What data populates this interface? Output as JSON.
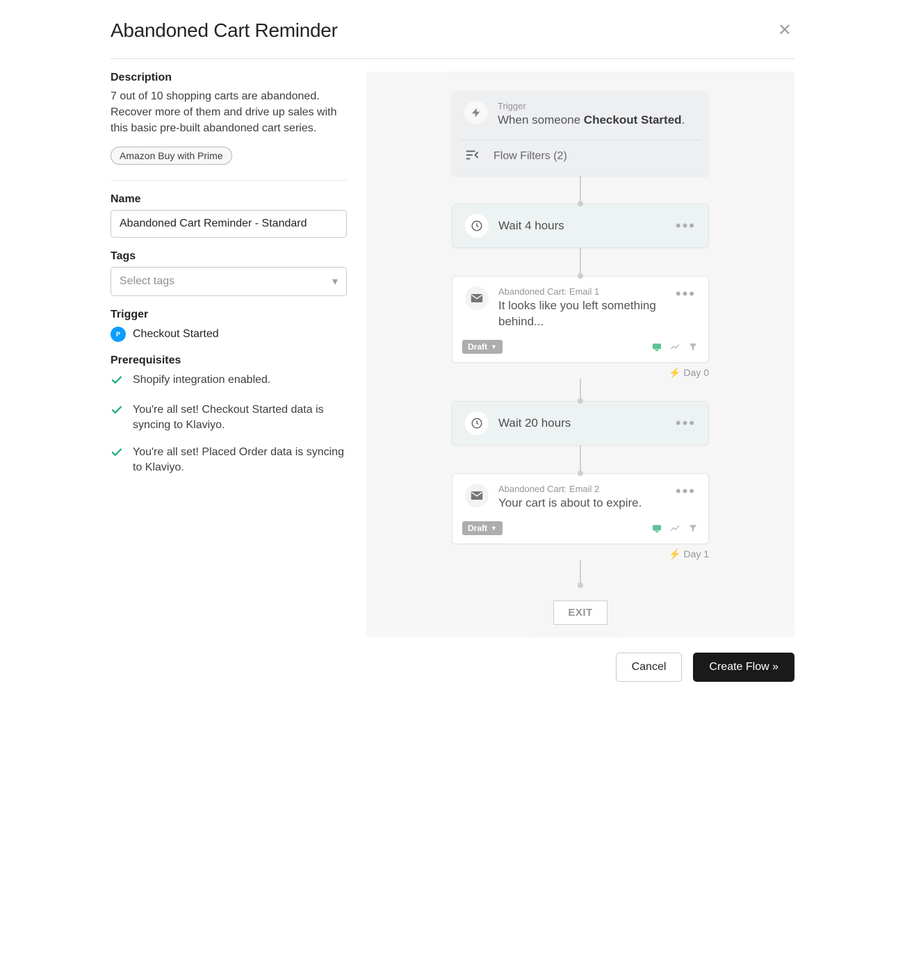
{
  "header": {
    "title": "Abandoned Cart Reminder"
  },
  "description": {
    "label": "Description",
    "text": "7 out of 10 shopping carts are abandoned. Recover more of them and drive up sales with this basic pre-built abandoned cart series.",
    "badge": "Amazon Buy with Prime"
  },
  "name": {
    "label": "Name",
    "value": "Abandoned Cart Reminder - Standard"
  },
  "tags": {
    "label": "Tags",
    "placeholder": "Select tags"
  },
  "trigger": {
    "label": "Trigger",
    "value": "Checkout Started"
  },
  "prerequisites": {
    "label": "Prerequisites",
    "items": [
      "Shopify integration enabled.",
      "You're all set! Checkout Started data is syncing to Klaviyo.",
      "You're all set! Placed Order data is syncing to Klaviyo."
    ]
  },
  "flow": {
    "trigger_section_label": "Trigger",
    "trigger_prefix": "When someone ",
    "trigger_event": "Checkout Started",
    "trigger_suffix": ".",
    "filters_label": "Flow Filters (2)",
    "steps": [
      {
        "type": "wait",
        "text": "Wait 4 hours"
      },
      {
        "type": "email",
        "label": "Abandoned Cart: Email 1",
        "subject": "It looks like you left something behind...",
        "status": "Draft",
        "day": "Day 0"
      },
      {
        "type": "wait",
        "text": "Wait 20 hours"
      },
      {
        "type": "email",
        "label": "Abandoned Cart: Email 2",
        "subject": "Your cart is about to expire.",
        "status": "Draft",
        "day": "Day 1"
      }
    ],
    "exit_label": "EXIT"
  },
  "footer": {
    "cancel": "Cancel",
    "create": "Create Flow »"
  }
}
